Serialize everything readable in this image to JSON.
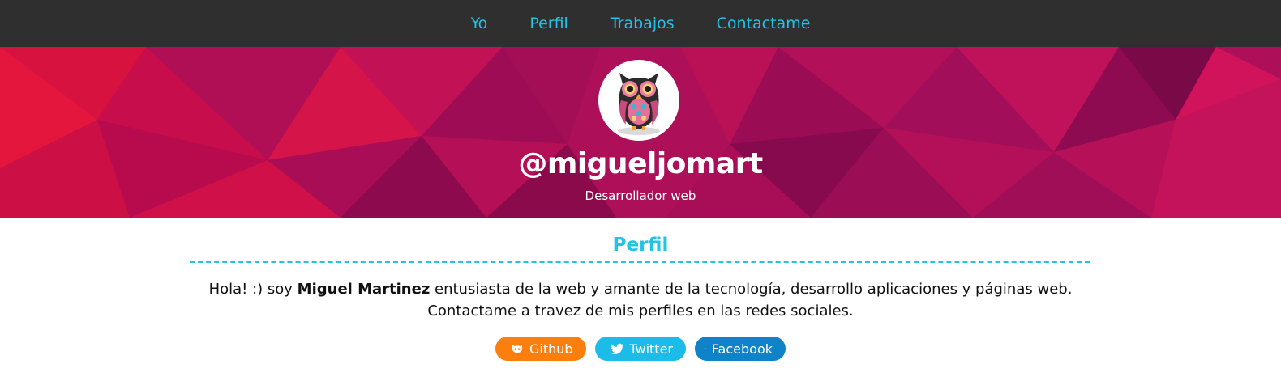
{
  "nav": {
    "items": [
      {
        "label": "Yo"
      },
      {
        "label": "Perfil"
      },
      {
        "label": "Trabajos"
      },
      {
        "label": "Contactame"
      }
    ],
    "background": "#2f2f2f",
    "link_color": "#21c3e6"
  },
  "hero": {
    "handle": "@migueljomart",
    "subtitle": "Desarrollador web",
    "avatar_icon": "owl-avatar",
    "background": "#b0115a"
  },
  "profile": {
    "title": "Perfil",
    "bio_intro": "Hola! :) soy ",
    "bio_name": "Miguel Martinez",
    "bio_rest": " entusiasta de la web y amante de la tecnología, desarrollo aplicaciones y páginas web.",
    "bio_line2": "Contactame a travez de mis perfiles en las redes sociales."
  },
  "socials": [
    {
      "label": "Github",
      "icon": "github-icon",
      "color": "#fc7f0d"
    },
    {
      "label": "Twitter",
      "icon": "twitter-icon",
      "color": "#1dbbe8"
    },
    {
      "label": "Facebook",
      "icon": "facebook-icon",
      "color": "#0f83c7"
    }
  ]
}
